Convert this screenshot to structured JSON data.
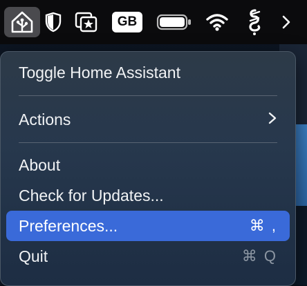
{
  "menubar": {
    "icons": [
      {
        "name": "home-assistant-icon"
      },
      {
        "name": "shield-icon"
      },
      {
        "name": "star-window-icon"
      },
      {
        "name": "input-source-badge",
        "label": "GB"
      },
      {
        "name": "battery-icon"
      },
      {
        "name": "wifi-icon"
      },
      {
        "name": "script-app-icon"
      },
      {
        "name": "chevron-right-icon"
      }
    ],
    "badge_label": "GB"
  },
  "menu": {
    "items": [
      {
        "label": "Toggle Home Assistant"
      },
      {
        "label": "Actions",
        "submenu_indicator": "›"
      },
      {
        "label": "About"
      },
      {
        "label": "Check for Updates..."
      },
      {
        "label": "Preferences...",
        "shortcut": "⌘ ,"
      },
      {
        "label": "Quit",
        "shortcut": "⌘ Q"
      }
    ]
  },
  "colors": {
    "selection": "#3a6ad9",
    "menu_bg": "#27384d"
  }
}
